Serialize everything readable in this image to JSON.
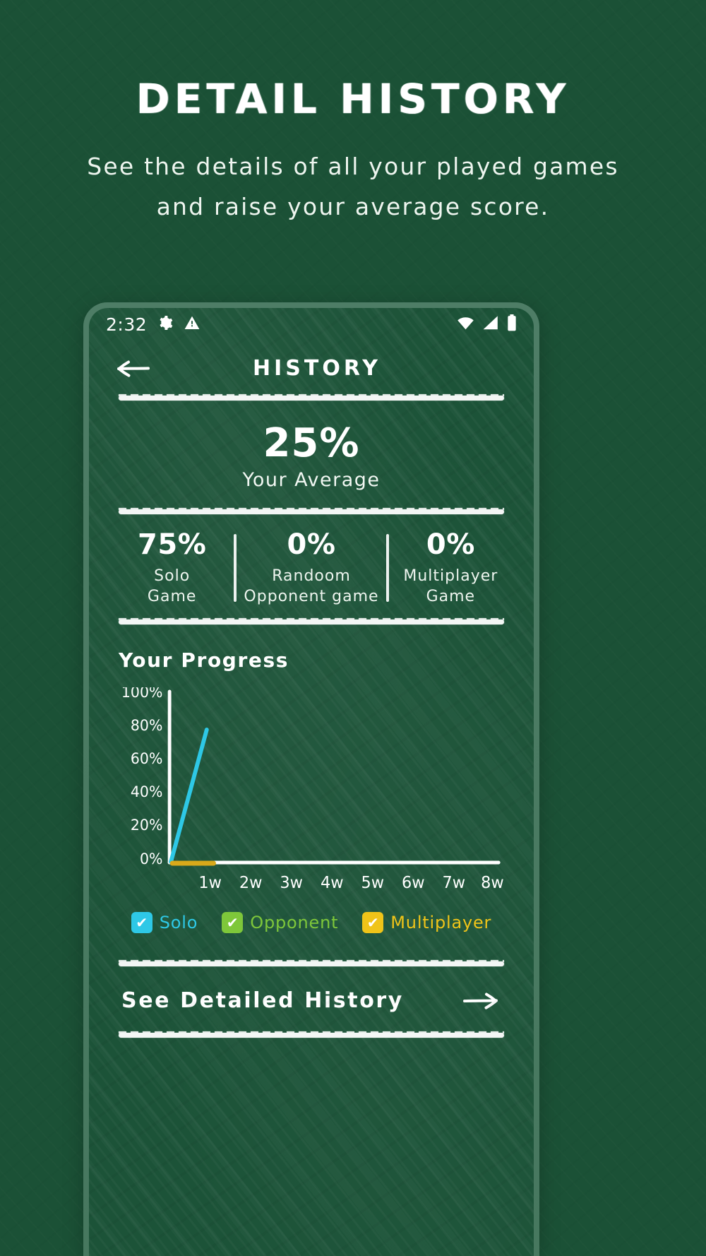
{
  "hero": {
    "title": "DETAIL HISTORY",
    "subtitle": "See the details of all your played games and raise your average score."
  },
  "phone": {
    "status_bar": {
      "time": "2:32",
      "icons_left": [
        "gear-icon",
        "warning-triangle-icon"
      ],
      "icons_right": [
        "wifi-icon",
        "cell-signal-icon",
        "battery-icon"
      ]
    },
    "app_header": {
      "back_icon": "back-arrow-icon",
      "title": "HISTORY"
    },
    "average": {
      "value": "25%",
      "label": "Your Average"
    },
    "stats": [
      {
        "value": "75%",
        "label": "Solo\nGame",
        "label_line1": "Solo",
        "label_line2": "Game"
      },
      {
        "value": "0%",
        "label": "Randoom Opponent game",
        "label_line1": "Randoom",
        "label_line2": "Opponent game"
      },
      {
        "value": "0%",
        "label": "Multiplayer Game",
        "label_line1": "Multiplayer",
        "label_line2": "Game"
      }
    ],
    "progress": {
      "title": "Your Progress",
      "legend": [
        {
          "label": "Solo",
          "color": "#2ec8e6",
          "check": "✔"
        },
        {
          "label": "Opponent",
          "color": "#7ec73a",
          "check": "✔"
        },
        {
          "label": "Multiplayer",
          "color": "#f0c419",
          "check": "✔"
        }
      ]
    },
    "footer": {
      "see_label": "See Detailed History",
      "arrow_icon": "arrow-right-icon"
    }
  },
  "colors": {
    "board": "#1b5136",
    "screen": "#1c5338",
    "chalk": "#ffffff",
    "solo": "#2ec8e6",
    "opponent": "#7ec73a",
    "multiplayer": "#f0c419"
  },
  "chart_data": {
    "type": "line",
    "title": "Your Progress",
    "xlabel": "",
    "ylabel": "",
    "x": [
      "1w",
      "2w",
      "3w",
      "4w",
      "5w",
      "6w",
      "7w",
      "8w"
    ],
    "ytick_labels": [
      "0%",
      "20%",
      "40%",
      "60%",
      "80%",
      "100%"
    ],
    "yticks": [
      0,
      20,
      40,
      60,
      80,
      100
    ],
    "ylim": [
      0,
      100
    ],
    "grid": false,
    "legend_position": "bottom",
    "series": [
      {
        "name": "Solo",
        "color": "#2ec8e6",
        "values": [
          75,
          null,
          null,
          null,
          null,
          null,
          null,
          null
        ]
      },
      {
        "name": "Opponent",
        "color": "#7ec73a",
        "values": [
          0,
          null,
          null,
          null,
          null,
          null,
          null,
          null
        ]
      },
      {
        "name": "Multiplayer",
        "color": "#f0c419",
        "values": [
          0,
          null,
          null,
          null,
          null,
          null,
          null,
          null
        ]
      }
    ]
  }
}
